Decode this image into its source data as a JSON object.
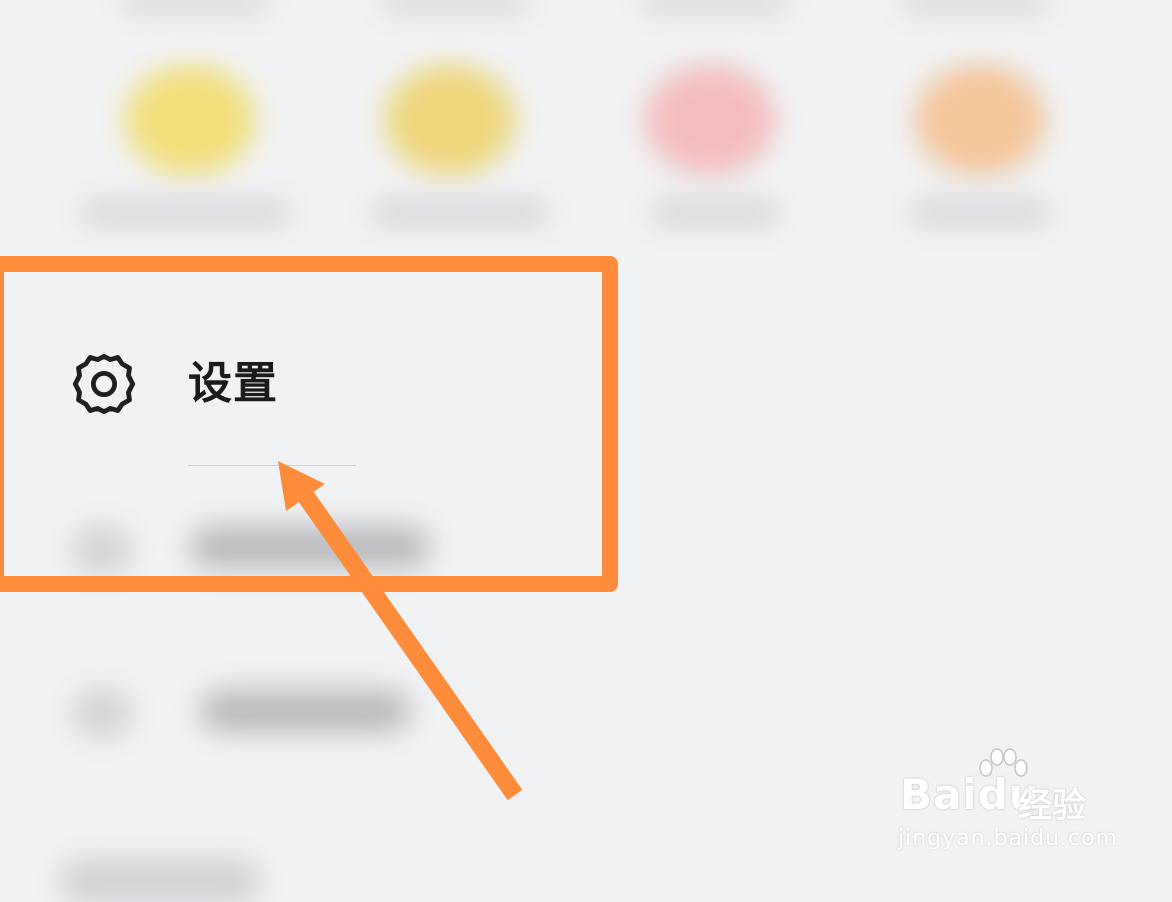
{
  "settings": {
    "label": "设置",
    "icon": "gear-icon"
  },
  "annotation": {
    "box_color": "#ff8c3a",
    "arrow_color": "#ff8c3a"
  },
  "watermark": {
    "brand": "Bai",
    "brand_suffix": "du",
    "product": "经验",
    "url": "jingyan.baidu.com"
  },
  "blurred_apps": [
    {
      "icon": "yellow-app-icon",
      "color": "#f2df7a"
    },
    {
      "icon": "yellow-app-icon",
      "color": "#eed67a"
    },
    {
      "icon": "pink-app-icon",
      "color": "#f3bcbc"
    },
    {
      "icon": "orange-app-icon",
      "color": "#f2c59a"
    }
  ]
}
